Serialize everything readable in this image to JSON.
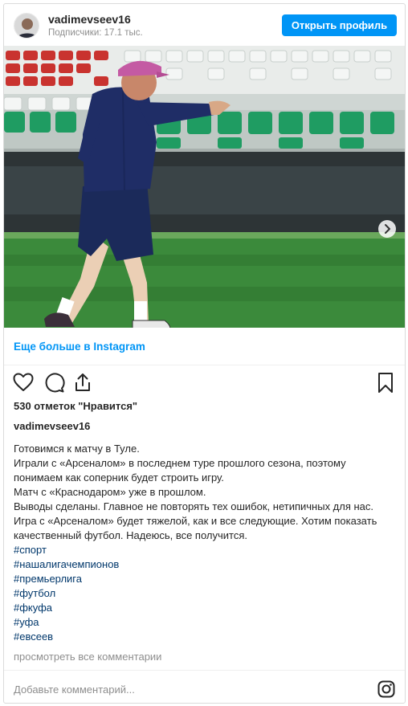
{
  "header": {
    "username": "vadimevseev16",
    "subscribers": "Подписчики: 17.1 тыс.",
    "open_profile_label": "Открыть профиль"
  },
  "carousel": {
    "total_slides": 3,
    "active_slide": 1
  },
  "more_link": "Еще больше в Instagram",
  "actions": {
    "icons": [
      "heart-icon",
      "comment-icon",
      "share-icon",
      "bookmark-icon"
    ]
  },
  "likes_text": "530 отметок \"Нравится\"",
  "owner": "vadimevseev16",
  "caption": {
    "lines": [
      "Готовимся к матчу в Туле.",
      "Играли с «Арсеналом» в последнем туре прошлого сезона, поэтому",
      "понимаем как соперник будет строить игру.",
      "Матч с «Краснодаром» уже в прошлом.",
      "Выводы сделаны. Главное не повторять тех ошибок, нетипичных для нас.",
      "Игра с «Арсеналом» будет тяжелой, как и все следующие. Хотим показать",
      "качественный футбол. Надеюсь, все получится."
    ],
    "hashtags": [
      "#спорт",
      "#нашалигачемпионов",
      "#премьерлига",
      "#футбол",
      "#фкуфа",
      "#уфа",
      "#евсеев"
    ]
  },
  "view_all_comments": "просмотреть все комментарии",
  "comment_placeholder": "Добавьте комментарий...",
  "colors": {
    "accent": "#0095f6",
    "hashtag": "#00376b",
    "muted": "#8e8e8e"
  }
}
